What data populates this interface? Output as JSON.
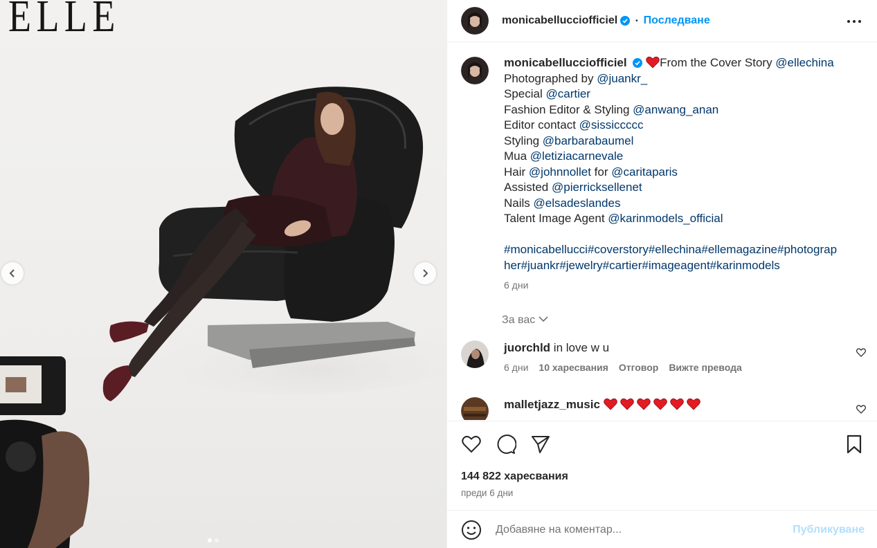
{
  "photo": {
    "magazine_logo": "ELLE",
    "prev_icon": "chevron-left-icon",
    "next_icon": "chevron-right-icon"
  },
  "header": {
    "username": "monicabelluccioffiсiel",
    "separator": "•",
    "follow_label": "Последване",
    "more_icon": "more-horizontal-icon"
  },
  "caption": {
    "username": "monicabelluccioffiсiel",
    "lines": [
      {
        "text": "From the Cover Story ",
        "mention": "@ellechina",
        "heart": true
      },
      {
        "text": "Photographed by ",
        "mention": "@juankr_"
      },
      {
        "text": "Special ",
        "mention": "@cartier"
      },
      {
        "text": "Fashion Editor & Styling ",
        "mention": "@anwang_anan"
      },
      {
        "text": "Editor contact ",
        "mention": "@sissiccccc"
      },
      {
        "text": "Styling ",
        "mention": "@barbarabaumel"
      },
      {
        "text": "Mua ",
        "mention": "@letiziacarnevale"
      },
      {
        "text": "Hair ",
        "mention": "@johnnollet",
        "text2": " for ",
        "mention2": "@caritaparis"
      },
      {
        "text": "Assisted ",
        "mention": "@pierricksellenet"
      },
      {
        "text": "Nails ",
        "mention": "@elsadeslandes"
      },
      {
        "text": "Talent Image Agent ",
        "mention": "@karinmodels_official"
      }
    ],
    "hashtags_line1": "#monicabellucci#coverstory#ellechina#ellemagazine#photograp",
    "hashtags_line2": "her#juankr#jewelry#cartier#imageagent#karinmodels",
    "time": "6 дни"
  },
  "for_you_label": "За вас",
  "comments": [
    {
      "username": "juorchld",
      "text": "in love w u",
      "time": "6 дни",
      "likes": "10 харесвания",
      "reply": "Отговор",
      "translate": "Вижте превода"
    },
    {
      "username": "malletjazz_music",
      "hearts": 6
    }
  ],
  "actions": {
    "likes": "144 822 харесвания",
    "posted": "преди 6 дни"
  },
  "add_comment": {
    "placeholder": "Добавяне на коментар...",
    "post_label": "Публикуване"
  },
  "colors": {
    "accent": "#0095f6",
    "link": "#00376b",
    "heart": "#e31b23",
    "muted": "#737373",
    "post_disabled": "#b2dffc"
  }
}
